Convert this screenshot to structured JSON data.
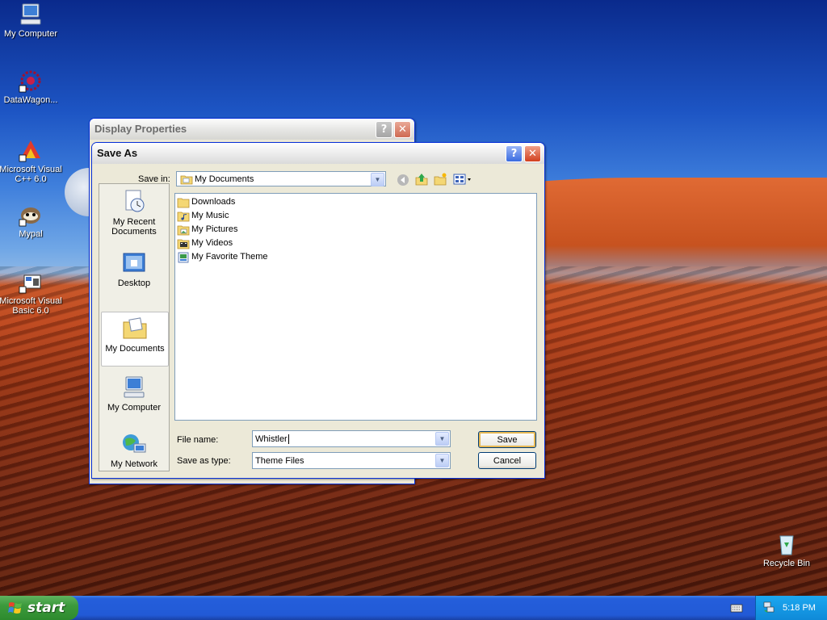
{
  "desktop": {
    "icons": [
      {
        "label": "My Computer",
        "icon": "computer-icon"
      },
      {
        "label": "DataWagon...",
        "icon": "datawagon-icon"
      },
      {
        "label": "Microsoft Visual C++ 6.0",
        "icon": "visual-cpp-icon"
      },
      {
        "label": "Mypal",
        "icon": "mypal-icon"
      },
      {
        "label": "Microsoft Visual Basic 6.0",
        "icon": "visual-basic-icon"
      },
      {
        "label": "Recycle Bin",
        "icon": "recycle-bin-icon"
      }
    ]
  },
  "display_properties": {
    "title": "Display Properties",
    "help": "?",
    "close": "✕"
  },
  "save_as": {
    "title": "Save As",
    "help": "?",
    "close": "✕",
    "save_in_label": "Save in:",
    "save_in_value": "My Documents",
    "places": [
      {
        "label": "My Recent Documents",
        "icon": "recent-documents-icon"
      },
      {
        "label": "Desktop",
        "icon": "desktop-icon"
      },
      {
        "label": "My Documents",
        "icon": "my-documents-icon",
        "selected": true
      },
      {
        "label": "My Computer",
        "icon": "computer-icon"
      },
      {
        "label": "My Network",
        "icon": "network-icon"
      }
    ],
    "files": [
      {
        "name": "Downloads",
        "icon": "folder-icon"
      },
      {
        "name": "My Music",
        "icon": "music-folder-icon"
      },
      {
        "name": "My Pictures",
        "icon": "pictures-folder-icon"
      },
      {
        "name": "My Videos",
        "icon": "videos-folder-icon"
      },
      {
        "name": "My Favorite Theme",
        "icon": "theme-file-icon"
      }
    ],
    "file_name_label": "File name:",
    "file_name_value": "Whistler",
    "save_as_type_label": "Save as type:",
    "save_as_type_value": "Theme Files",
    "save_button": "Save",
    "cancel_button": "Cancel"
  },
  "taskbar": {
    "start_label": "start",
    "clock": "5:18 PM"
  }
}
